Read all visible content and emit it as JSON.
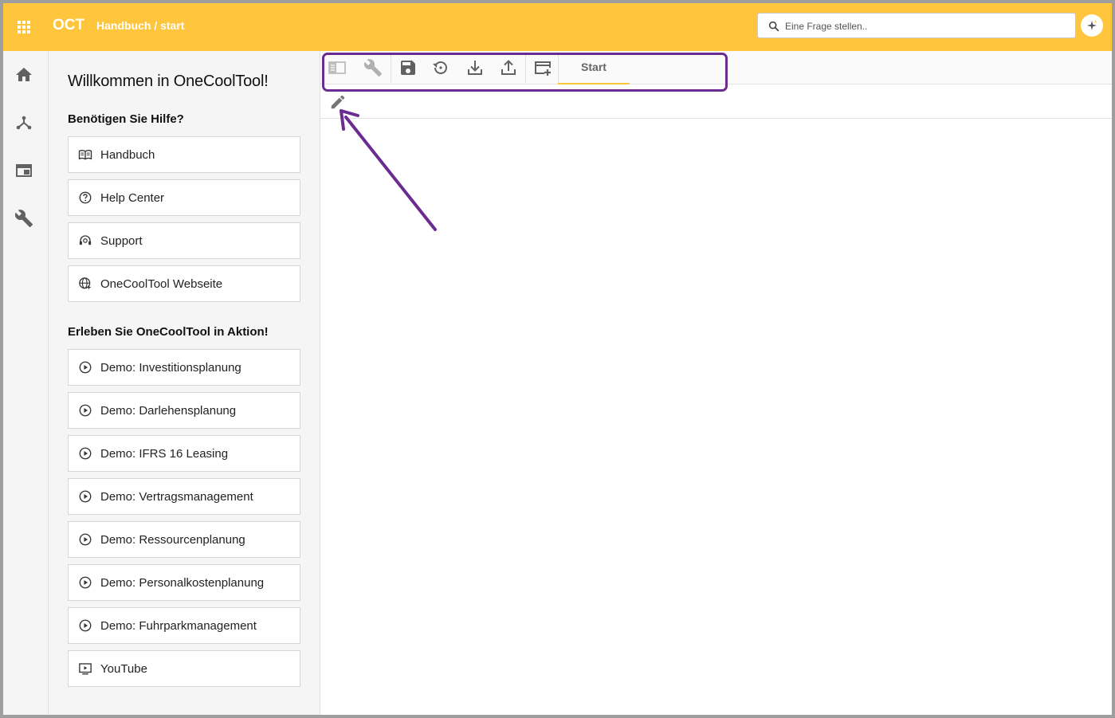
{
  "header": {
    "apps_icon": "apps-grid-icon",
    "brand": "OCT",
    "breadcrumb": "Handbuch / start",
    "search_placeholder": "Eine Frage stellen..",
    "ai_icon": "sparkle-icon"
  },
  "rail": {
    "items": [
      {
        "icon": "home-icon"
      },
      {
        "icon": "hierarchy-icon"
      },
      {
        "icon": "window-icon"
      },
      {
        "icon": "wrench-icon"
      }
    ]
  },
  "help": {
    "title": "Willkommen in OneCoolTool!",
    "section_help": "Benötigen Sie Hilfe?",
    "help_links": [
      {
        "label": "Handbuch",
        "icon": "book-icon"
      },
      {
        "label": "Help Center",
        "icon": "help-circle-icon"
      },
      {
        "label": "Support",
        "icon": "support-icon"
      },
      {
        "label": "OneCoolTool Webseite",
        "icon": "globe-icon"
      }
    ],
    "section_demo": "Erleben Sie OneCoolTool in Aktion!",
    "demo_links": [
      {
        "label": "Demo: Investitionsplanung",
        "icon": "play-circle-icon"
      },
      {
        "label": "Demo: Darlehensplanung",
        "icon": "play-circle-icon"
      },
      {
        "label": "Demo: IFRS 16 Leasing",
        "icon": "play-circle-icon"
      },
      {
        "label": "Demo: Vertragsmanagement",
        "icon": "play-circle-icon"
      },
      {
        "label": "Demo: Ressourcenplanung",
        "icon": "play-circle-icon"
      },
      {
        "label": "Demo: Personalkostenplanung",
        "icon": "play-circle-icon"
      },
      {
        "label": "Demo: Fuhrparkmanagement",
        "icon": "play-circle-icon"
      },
      {
        "label": "YouTube",
        "icon": "youtube-icon"
      }
    ]
  },
  "toolbar": {
    "buttons": [
      "sidebar-toggle-icon",
      "wrench-icon",
      "save-icon",
      "history-icon",
      "download-icon",
      "upload-icon",
      "add-window-icon"
    ],
    "tab_label": "Start",
    "edit_icon": "pencil-icon"
  },
  "colors": {
    "brand_yellow": "#ffc53d",
    "highlight_purple": "#6a2c91"
  }
}
